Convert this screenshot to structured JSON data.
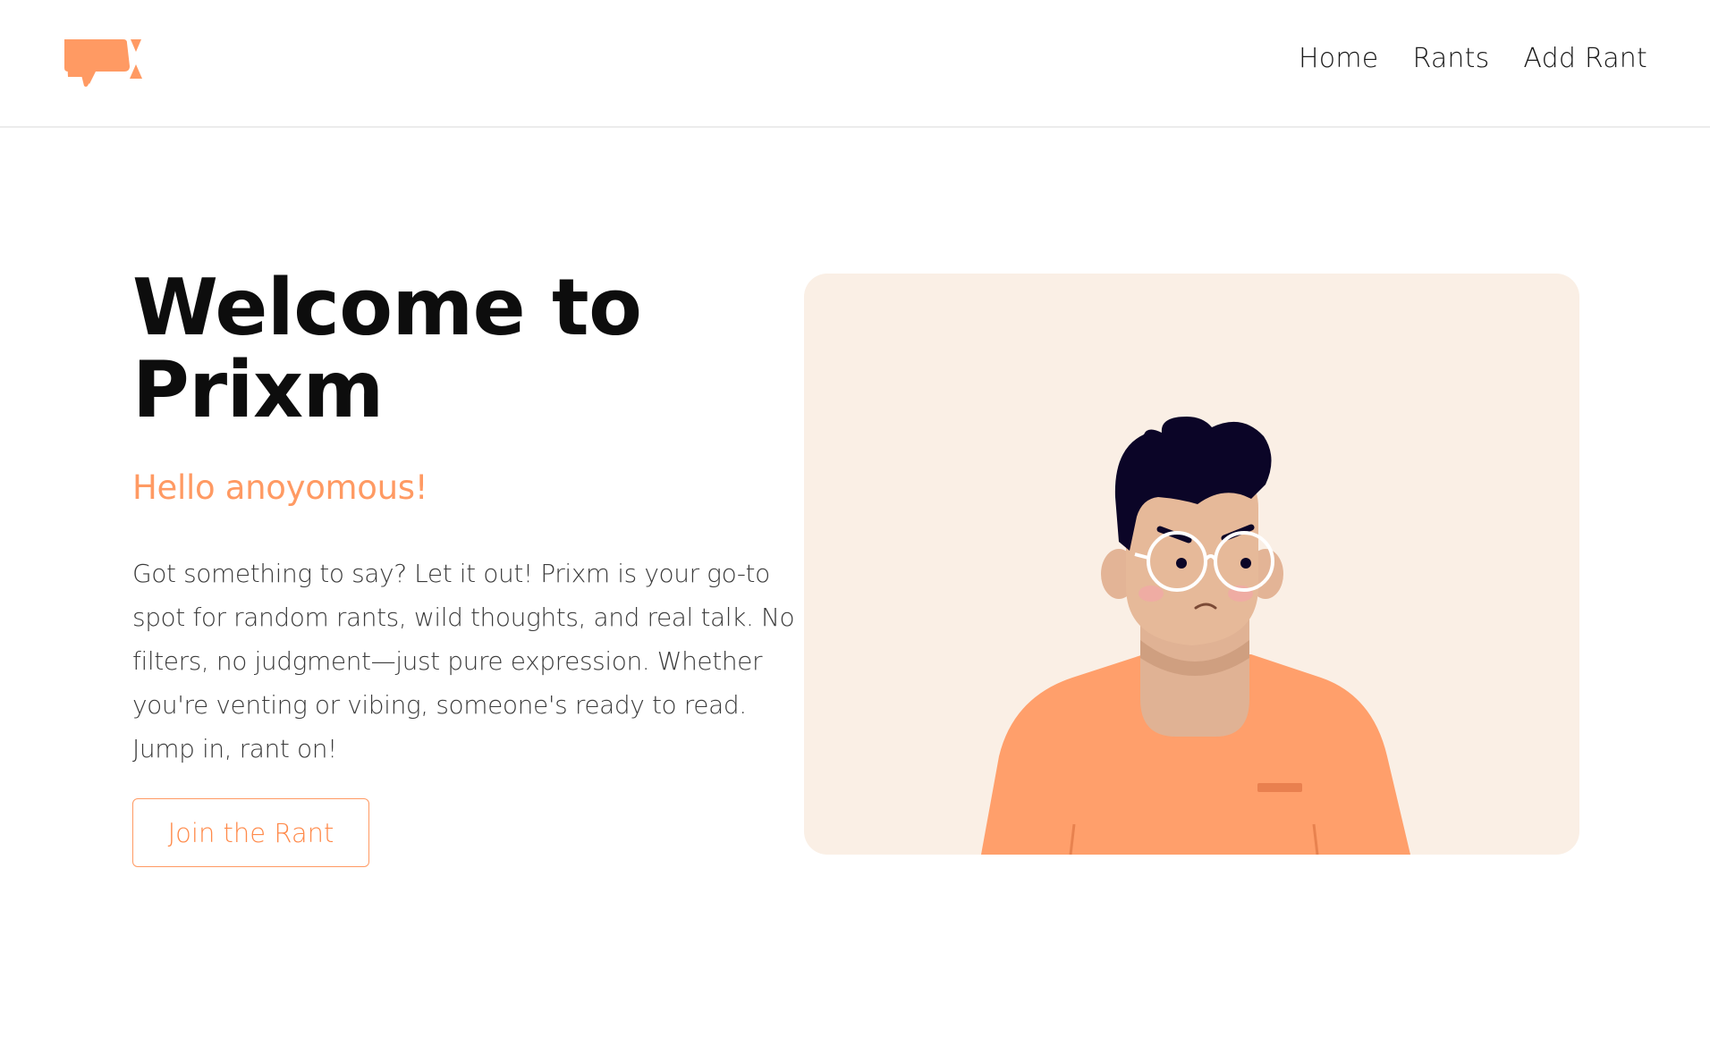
{
  "header": {
    "logo_icon": "speech-bubble-x-logo",
    "nav": [
      {
        "label": "Home"
      },
      {
        "label": "Rants"
      },
      {
        "label": "Add Rant"
      }
    ]
  },
  "hero": {
    "title": "Welcome to Prixm",
    "subtitle": "Hello anoyomous!",
    "description": "Got something to say? Let it out! Prixm is your go-to spot for random rants, wild thoughts, and real talk. No filters, no judgment—just pure expression. Whether you're venting or vibing, someone's ready to read. Jump in, rant on!",
    "cta_label": "Join the Rant",
    "illustration": "grumpy-man-with-glasses-illustration"
  },
  "colors": {
    "accent": "#ff9a63",
    "card_bg": "#faefe5",
    "hair": "#0b0527",
    "skin": "#e3b496"
  }
}
